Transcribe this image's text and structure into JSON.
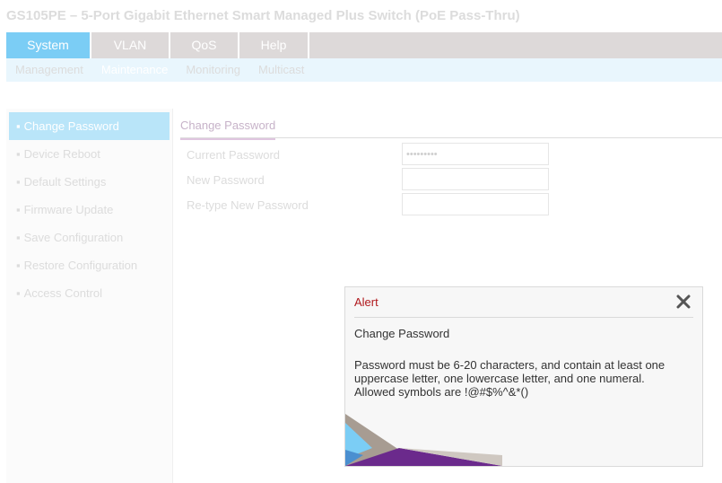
{
  "app": {
    "title": "GS105PE – 5-Port Gigabit Ethernet Smart Managed Plus Switch (PoE Pass-Thru)"
  },
  "main_tabs": [
    {
      "label": "System",
      "active": true
    },
    {
      "label": "VLAN"
    },
    {
      "label": "QoS"
    },
    {
      "label": "Help"
    }
  ],
  "sub_tabs": [
    {
      "label": "Management"
    },
    {
      "label": "Maintenance",
      "active": true
    },
    {
      "label": "Monitoring"
    },
    {
      "label": "Multicast"
    }
  ],
  "sidebar": {
    "items": [
      {
        "label": "Change Password",
        "active": true
      },
      {
        "label": "Device Reboot"
      },
      {
        "label": "Default Settings"
      },
      {
        "label": "Firmware Update"
      },
      {
        "label": "Save Configuration"
      },
      {
        "label": "Restore Configuration"
      },
      {
        "label": "Access Control"
      }
    ]
  },
  "content": {
    "tab_label": "Change Password",
    "fields": {
      "current": {
        "label": "Current Password",
        "value": "•••••••••"
      },
      "new": {
        "label": "New Password",
        "value": ""
      },
      "retype": {
        "label": "Re-type New Password",
        "value": ""
      }
    }
  },
  "alert": {
    "title": "Alert",
    "subtitle": "Change Password",
    "message": "Password must be 6-20 characters, and contain at least one uppercase letter, one lowercase letter, and one numeral. Allowed symbols are !@#$%^&*()",
    "close_icon": "close-icon"
  },
  "colors": {
    "accent_blue": "#7bcdf5",
    "sidebar_active": "#b9e5f9",
    "alert_title": "#b0191d",
    "brand_purple": "#6b2a8c"
  }
}
